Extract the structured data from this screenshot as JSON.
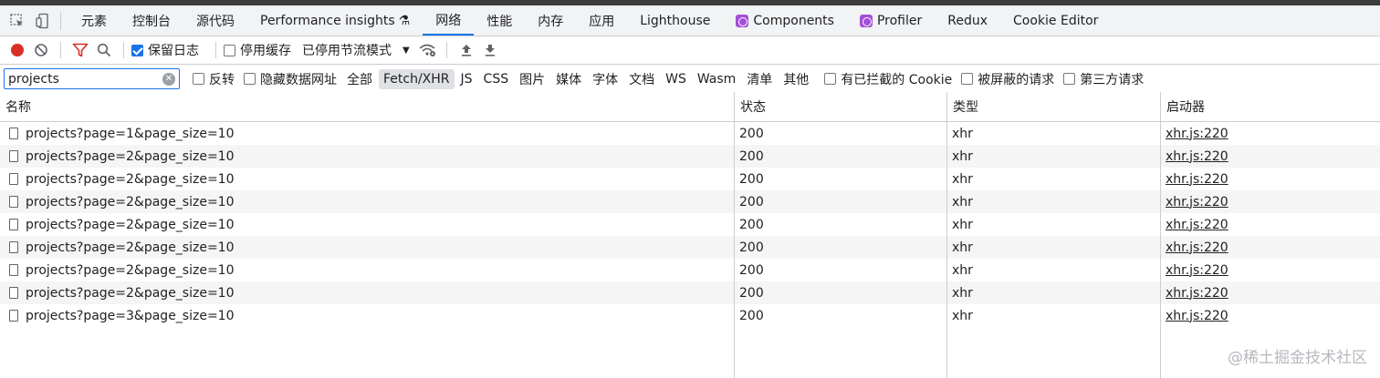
{
  "tabs": {
    "items": [
      {
        "label": "元素"
      },
      {
        "label": "控制台"
      },
      {
        "label": "源代码"
      },
      {
        "label": "Performance insights",
        "extra": "⚗"
      },
      {
        "label": "网络"
      },
      {
        "label": "性能"
      },
      {
        "label": "内存"
      },
      {
        "label": "应用"
      },
      {
        "label": "Lighthouse"
      },
      {
        "label": "Components"
      },
      {
        "label": "Profiler"
      },
      {
        "label": "Redux"
      },
      {
        "label": "Cookie Editor"
      }
    ],
    "active": "网络"
  },
  "toolbar": {
    "preserve_log": "保留日志",
    "disable_cache": "停用缓存",
    "throttling": "已停用节流模式"
  },
  "filter": {
    "search_value": "projects",
    "invert": "反转",
    "hide_data_urls": "隐藏数据网址",
    "types": [
      "全部",
      "Fetch/XHR",
      "JS",
      "CSS",
      "图片",
      "媒体",
      "字体",
      "文档",
      "WS",
      "Wasm",
      "清单",
      "其他"
    ],
    "active_type": "Fetch/XHR",
    "blocked_cookies": "有已拦截的 Cookie",
    "blocked_requests": "被屏蔽的请求",
    "third_party": "第三方请求"
  },
  "table": {
    "columns": [
      "名称",
      "状态",
      "类型",
      "启动器"
    ],
    "rows": [
      {
        "name": "projects?page=1&page_size=10",
        "status": "200",
        "type": "xhr",
        "initiator": "xhr.js:220"
      },
      {
        "name": "projects?page=2&page_size=10",
        "status": "200",
        "type": "xhr",
        "initiator": "xhr.js:220"
      },
      {
        "name": "projects?page=2&page_size=10",
        "status": "200",
        "type": "xhr",
        "initiator": "xhr.js:220"
      },
      {
        "name": "projects?page=2&page_size=10",
        "status": "200",
        "type": "xhr",
        "initiator": "xhr.js:220"
      },
      {
        "name": "projects?page=2&page_size=10",
        "status": "200",
        "type": "xhr",
        "initiator": "xhr.js:220"
      },
      {
        "name": "projects?page=2&page_size=10",
        "status": "200",
        "type": "xhr",
        "initiator": "xhr.js:220"
      },
      {
        "name": "projects?page=2&page_size=10",
        "status": "200",
        "type": "xhr",
        "initiator": "xhr.js:220"
      },
      {
        "name": "projects?page=2&page_size=10",
        "status": "200",
        "type": "xhr",
        "initiator": "xhr.js:220"
      },
      {
        "name": "projects?page=3&page_size=10",
        "status": "200",
        "type": "xhr",
        "initiator": "xhr.js:220"
      }
    ]
  },
  "watermark": "@稀土掘金技术社区",
  "colors": {
    "accent": "#1a73e8",
    "record": "#d93025",
    "filter": "#d93025",
    "badge": "#a34fd6"
  }
}
